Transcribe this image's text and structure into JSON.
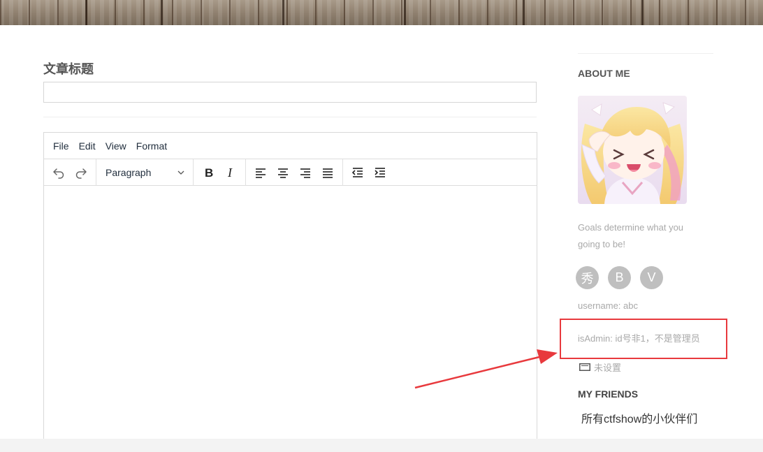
{
  "page": {
    "title_label": "文章标题",
    "title_value": ""
  },
  "editor": {
    "menu": [
      "File",
      "Edit",
      "View",
      "Format"
    ],
    "block_format": "Paragraph",
    "toolbar_icons": {
      "undo": "undo-icon",
      "redo": "redo-icon",
      "bold": "bold-icon",
      "italic": "italic-icon",
      "align_left": "align-left-icon",
      "align_center": "align-center-icon",
      "align_right": "align-right-icon",
      "align_justify": "align-justify-icon",
      "outdent": "outdent-icon",
      "indent": "indent-icon"
    },
    "content": ""
  },
  "sidebar": {
    "about_title": "ABOUT ME",
    "motto": "Goals determine what you going to be!",
    "social": [
      "秀",
      "B",
      "V"
    ],
    "username": "username: abc",
    "is_admin": "isAdmin: id号非1，不是管理员",
    "email": "未设置",
    "friends_title": "MY FRIENDS",
    "friends_link": "所有ctfshow的小伙伴们"
  },
  "annotation": {
    "color": "#e8393d"
  }
}
